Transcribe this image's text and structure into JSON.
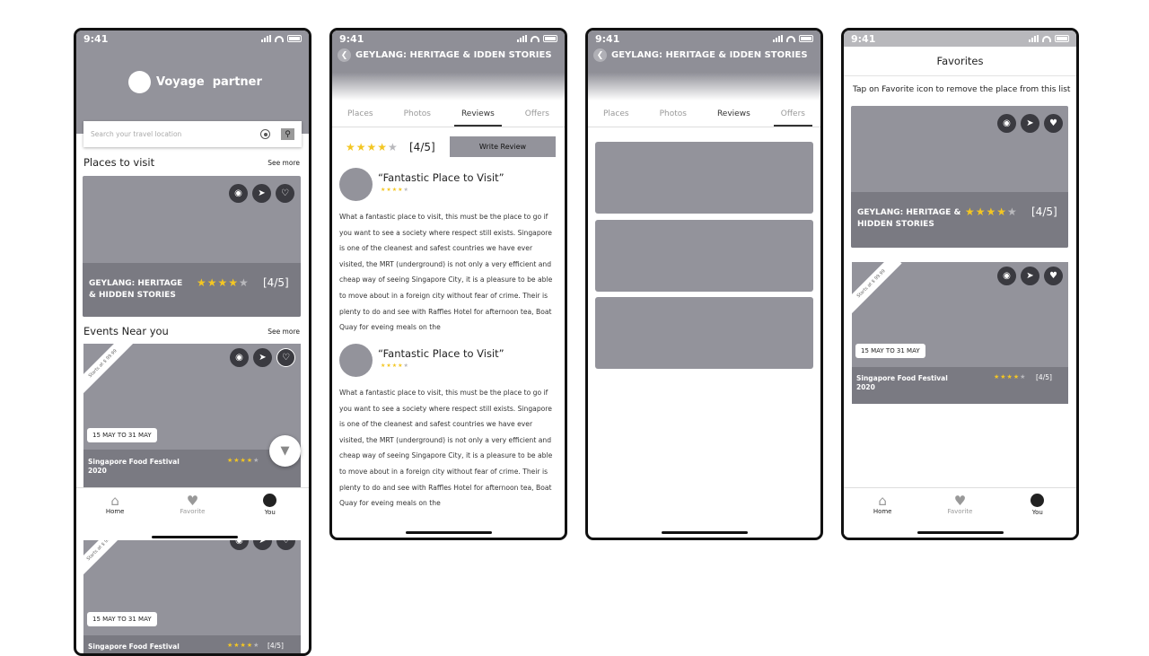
{
  "status_time": "9:41",
  "screen1": {
    "app_name": "Voyage  partner",
    "search_placeholder": "Search your travel location",
    "places_heading": "Places to visit",
    "see_more": "See more",
    "place_card": {
      "title": "GEYLANG: HERITAGE & HIDDEN STORIES",
      "rating_text": "[4/5]",
      "rating": 4
    },
    "events_heading": "Events Near you",
    "event_card": {
      "ribbon": "Starts at $ 99.99",
      "date": "15 MAY TO 31 MAY",
      "title": "Singapore Food Festival 2020",
      "rating": 4
    },
    "event_card2": {
      "date": "15 MAY TO 31 MAY",
      "title": "Singapore Food Festival",
      "rating_text": "[4/5]"
    },
    "nav": {
      "home": "Home",
      "favorite": "Favorite",
      "you": "You"
    }
  },
  "screen2": {
    "header_title": "GEYLANG: HERITAGE & IDDEN STORIES",
    "tabs": [
      "Places",
      "Photos",
      "Reviews",
      "Offers"
    ],
    "rating_text": "[4/5]",
    "rating": 4,
    "write_review": "Write Review",
    "reviews": [
      {
        "title": "“Fantastic Place to Visit”",
        "body": "What a fantastic place to visit, this must be the place to go if you want to see a society where respect still exists. Singapore is one of the cleanest and safest countries we have ever visited, the MRT (underground) is not only a very efficient and cheap way of seeing Singapore City, it is a pleasure to be able to move about in a foreign city without fear of crime. Their is plenty to do and see with Raffles Hotel for afternoon tea, Boat Quay for eveing meals on the"
      },
      {
        "title": "“Fantastic Place to Visit”",
        "body": "What a fantastic place to visit, this must be the place to go if you want to see a society where respect still exists. Singapore is one of the cleanest and safest countries we have ever visited, the MRT (underground) is not only a very efficient and cheap way of seeing Singapore City, it is a pleasure to be able to move about in a foreign city without fear of crime. Their is plenty to do and see with Raffles Hotel for afternoon tea, Boat Quay for eveing meals on the"
      }
    ]
  },
  "screen3": {
    "header_title": "GEYLANG: HERITAGE & IDDEN STORIES",
    "tabs": [
      "Places",
      "Photos",
      "Reviews",
      "Offers"
    ]
  },
  "screen4": {
    "title": "Favorites",
    "instruction": "Tap on Favorite icon to remove the place from this list",
    "place_card": {
      "title": "GEYLANG: HERITAGE & HIDDEN STORIES",
      "rating_text": "[4/5]",
      "rating": 4
    },
    "event_card": {
      "ribbon": "Starts at $ 99.99",
      "date": "15 MAY TO 31 MAY",
      "title": "Singapore Food Festival 2020",
      "rating_text": "[4/5]",
      "rating": 4
    },
    "nav": {
      "home": "Home",
      "favorite": "Favorite",
      "you": "You"
    }
  }
}
